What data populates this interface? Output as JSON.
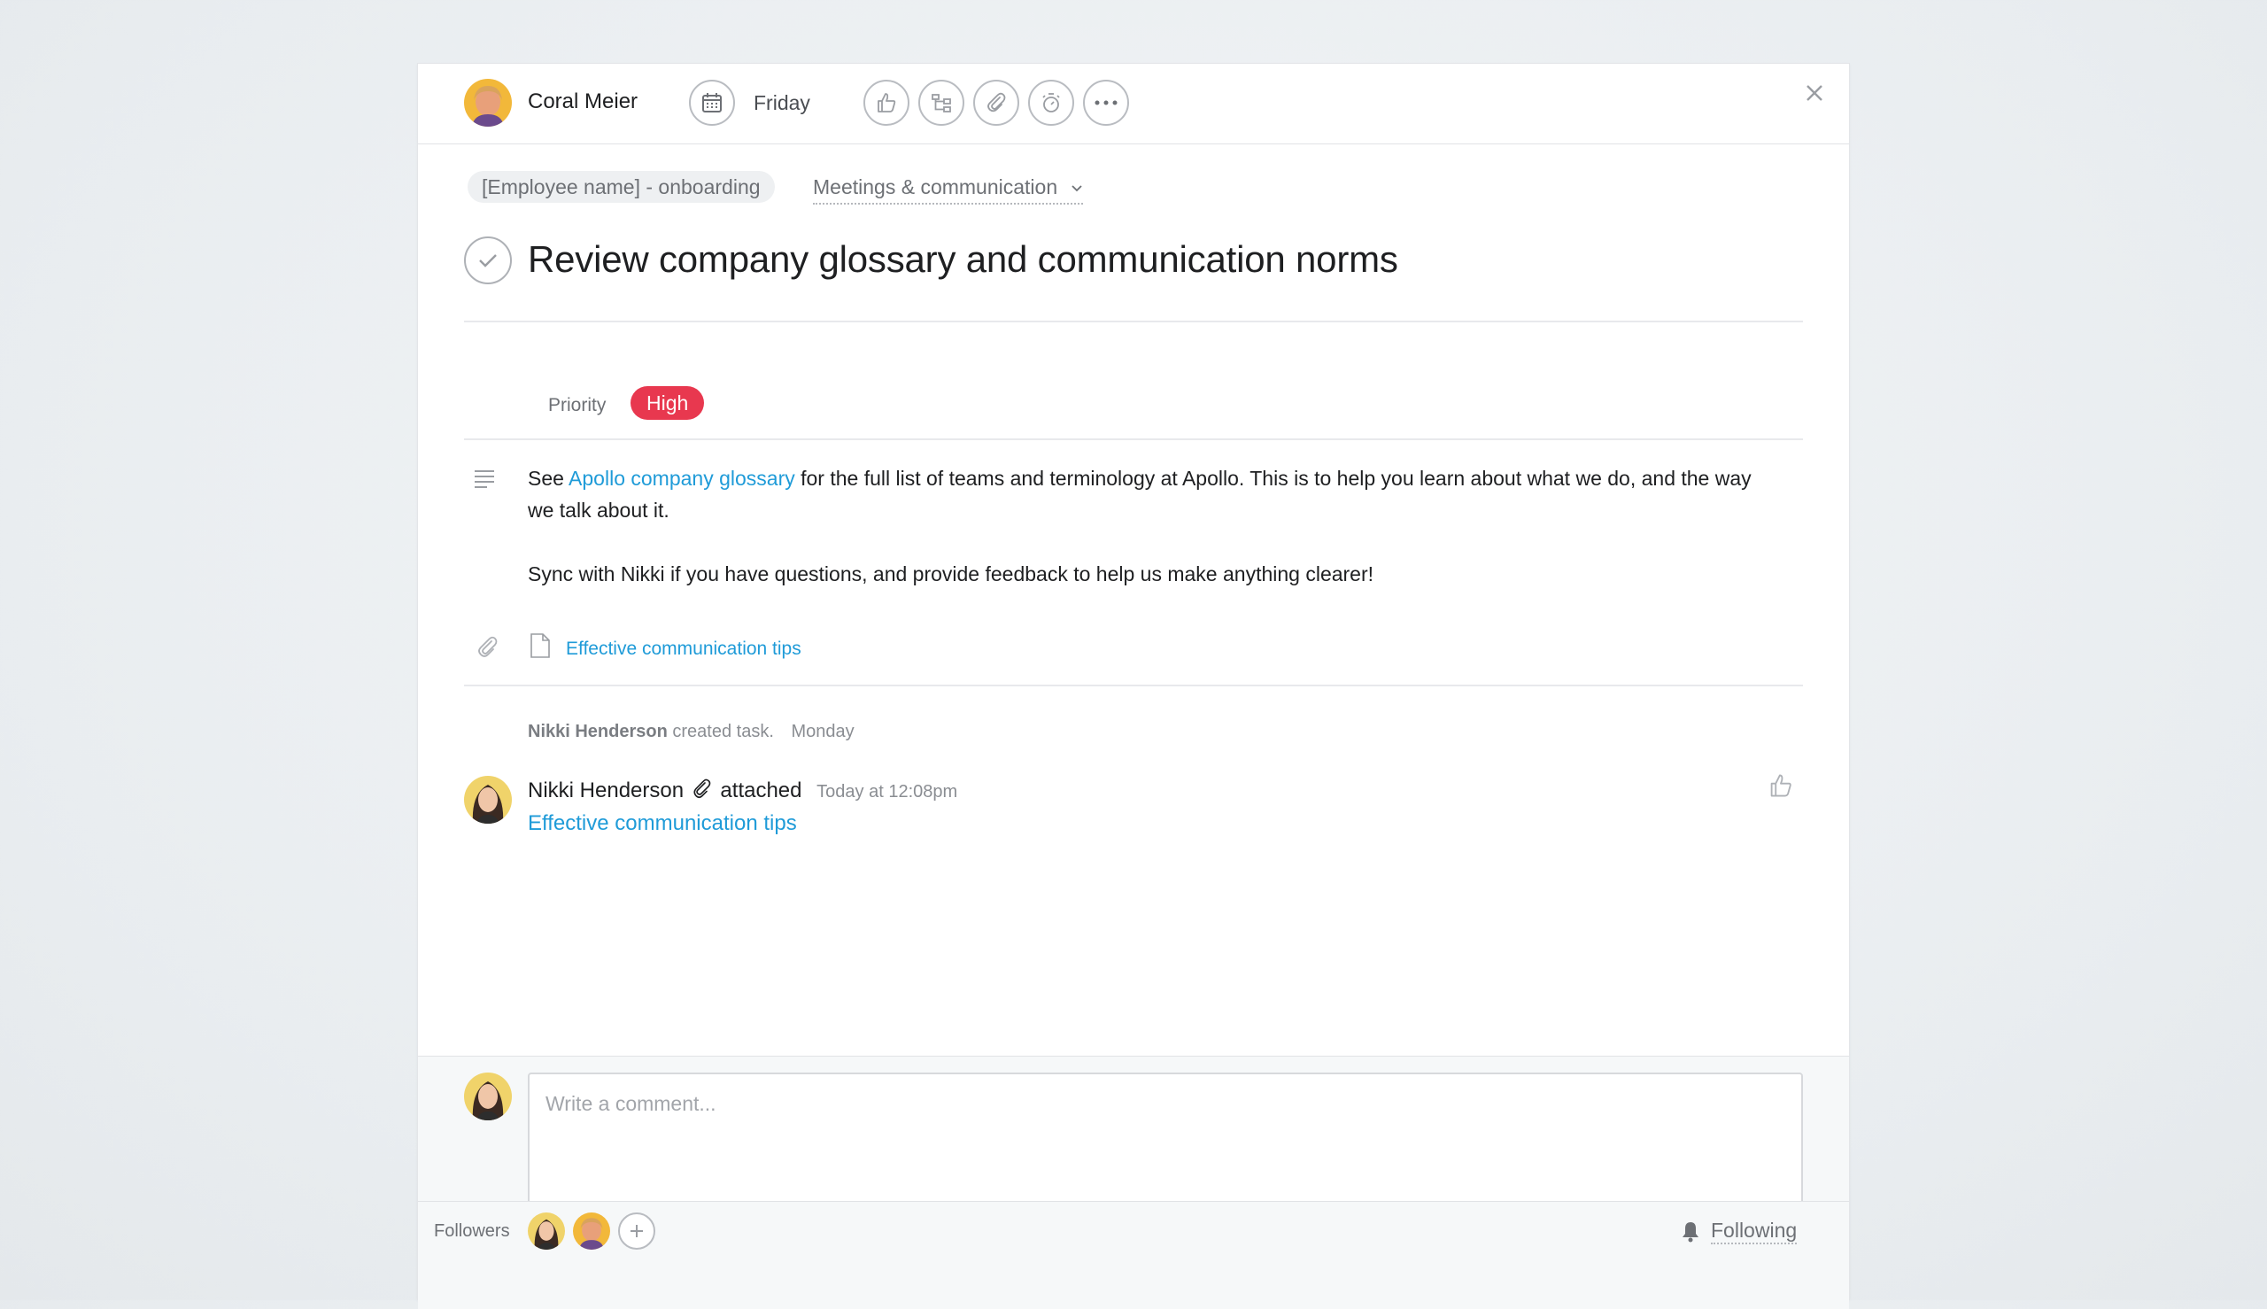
{
  "header": {
    "assignee": "Coral Meier",
    "due_date": "Friday"
  },
  "breadcrumb": {
    "project": "[Employee name] - onboarding",
    "section": "Meetings & communication"
  },
  "task": {
    "title": "Review company glossary and communication norms"
  },
  "fields": {
    "priority_label": "Priority",
    "priority_value": "High",
    "priority_color": "#e8384f"
  },
  "description": {
    "p1_before": "See ",
    "p1_link": "Apollo company glossary",
    "p1_after": " for the full list of teams and terminology at Apollo. This is to help you learn about what we do, and the way we talk about it.",
    "p2": "Sync with Nikki if you have questions, and provide feedback to help us make anything clearer!"
  },
  "attachment": {
    "name": "Effective communication tips"
  },
  "activity": {
    "creator": "Nikki Henderson",
    "created_text": "created task.",
    "created_when": "Monday",
    "comment_author": "Nikki Henderson",
    "comment_action": "attached",
    "comment_time": "Today at 12:08pm",
    "comment_link": "Effective communication tips"
  },
  "composer": {
    "placeholder": "Write a comment..."
  },
  "followers": {
    "label": "Followers",
    "following_label": "Following"
  },
  "colors": {
    "accent_link": "#1f9bd8",
    "priority_high": "#e8384f"
  }
}
